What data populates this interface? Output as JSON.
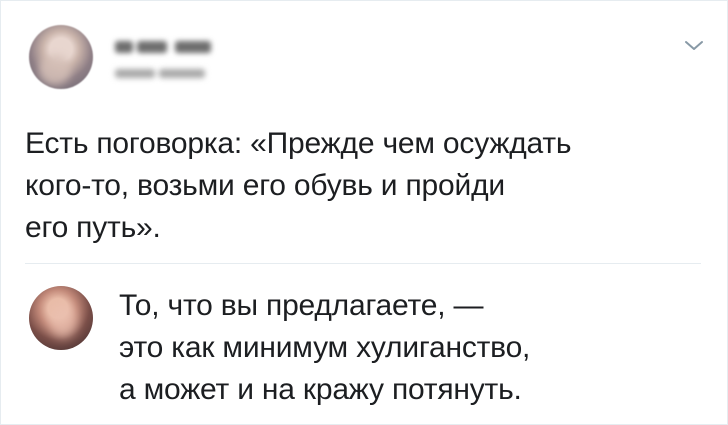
{
  "tweet": {
    "text": "Есть поговорка: «Прежде чем осуждать\nкого-то, возьми его обувь и пройди\nего путь»."
  },
  "reply": {
    "text": "То, что вы предлагаете, —\nэто как минимум хулиганство,\nа может и на кражу потянуть."
  },
  "icons": {
    "menu": "chevron-down-icon"
  },
  "colors": {
    "text": "#1c1e21",
    "divider": "#e6ecf0",
    "icon": "#8899a6"
  }
}
